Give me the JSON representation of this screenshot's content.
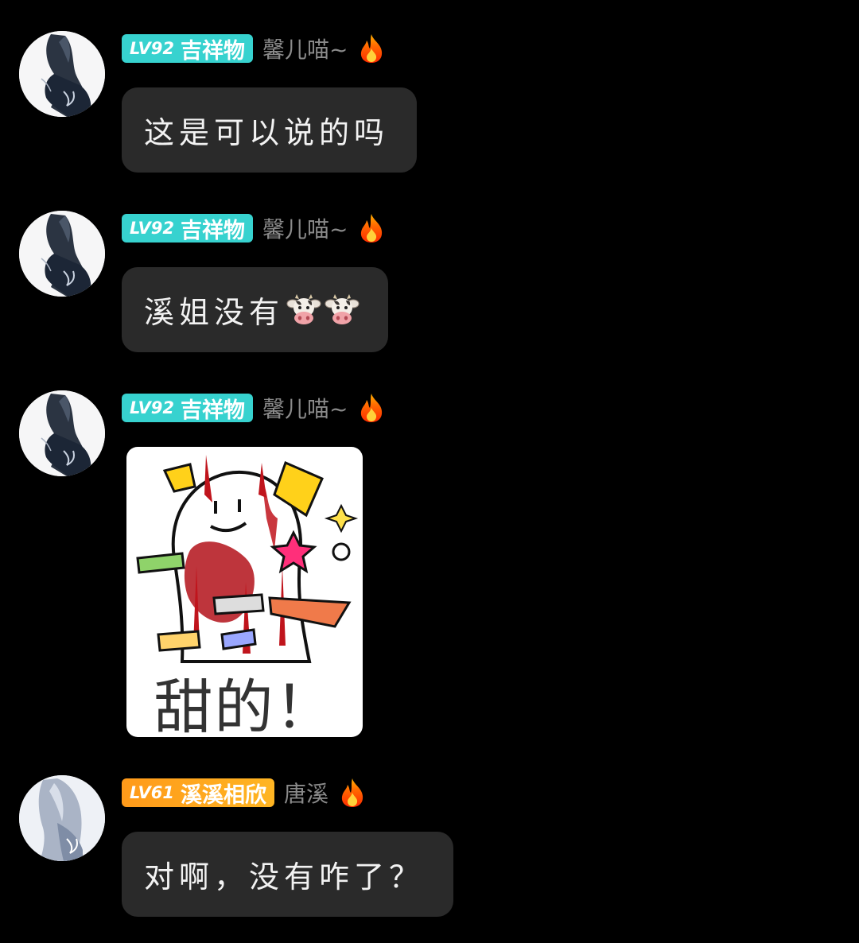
{
  "messages": [
    {
      "level": "LV92",
      "badge_title": "吉祥物",
      "badge_color": "#37d2cf",
      "username": "馨儿喵~",
      "icon": "fire-icon",
      "text": "这是可以说的吗"
    },
    {
      "level": "LV92",
      "badge_title": "吉祥物",
      "badge_color": "#37d2cf",
      "username": "馨儿喵~",
      "icon": "fire-icon",
      "text": "溪姐没有",
      "emoji": [
        "cow-face-emoji",
        "cow-face-emoji"
      ]
    },
    {
      "level": "LV92",
      "badge_title": "吉祥物",
      "badge_color": "#37d2cf",
      "username": "馨儿喵~",
      "icon": "fire-icon",
      "sticker_caption": "甜的！"
    },
    {
      "level": "LV61",
      "badge_title": "溪溪相欣",
      "badge_color": "#ffa41f",
      "username": "唐溪",
      "icon": "fire-icon",
      "text": "对啊，没有咋了？"
    }
  ]
}
